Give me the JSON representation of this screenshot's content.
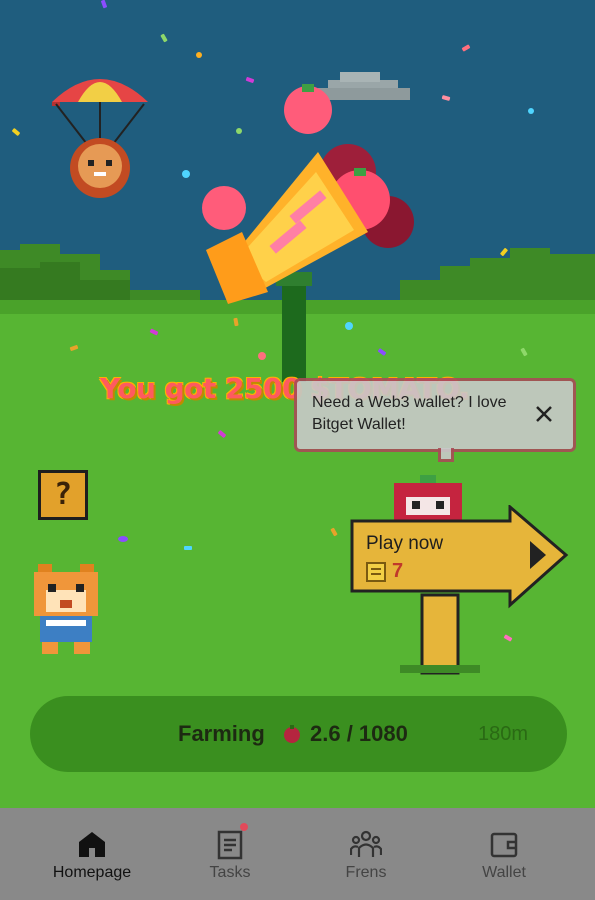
{
  "reward": {
    "message": "You got 2500 $TOMATO."
  },
  "bubble": {
    "text": "Need a Web3 wallet? I love Bitget Wallet!"
  },
  "mystery_box": {
    "symbol": "?"
  },
  "sign": {
    "title": "Play now",
    "count": "7"
  },
  "farming": {
    "label": "Farming",
    "value": "2.6 / 1080",
    "time": "180m"
  },
  "nav": [
    {
      "label": "Homepage",
      "icon": "home-icon",
      "active": true
    },
    {
      "label": "Tasks",
      "icon": "tasks-icon",
      "active": false,
      "badge": true
    },
    {
      "label": "Frens",
      "icon": "frens-icon",
      "active": false
    },
    {
      "label": "Wallet",
      "icon": "wallet-icon",
      "active": false
    }
  ],
  "colors": {
    "sky": "#1f5d7e",
    "grass": "#57b533",
    "farming_bar": "#3a8f1f",
    "nav_bg": "#898989",
    "headline": "#ff5a5f"
  }
}
